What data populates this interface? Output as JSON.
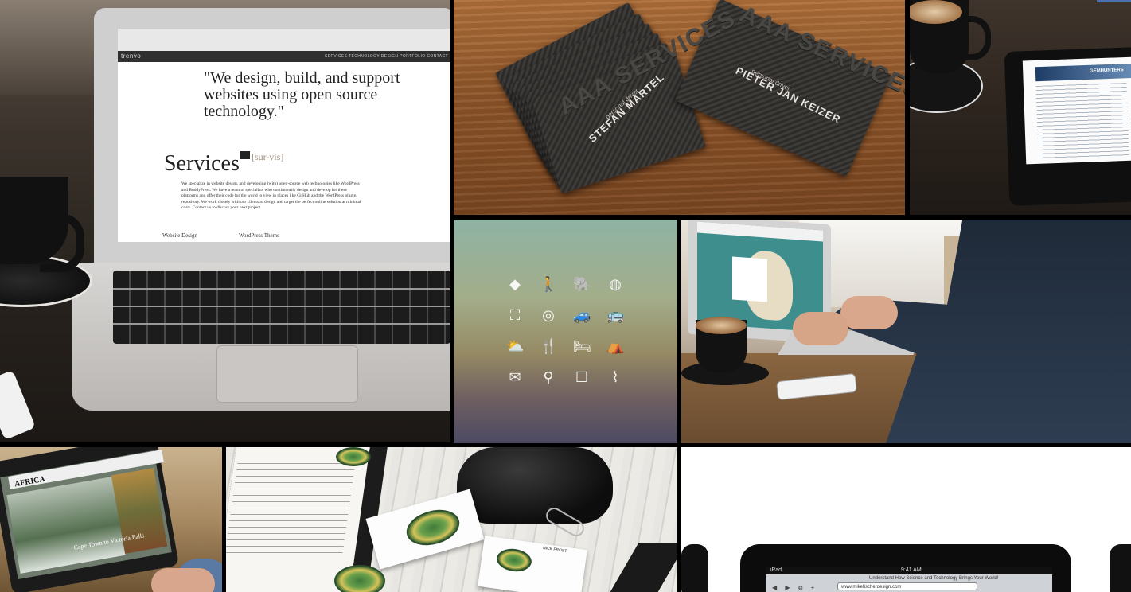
{
  "gallery": {
    "tile1": {
      "alt_label": "laptop-website",
      "brand": "trenvo",
      "nav": "SERVICES   TECHNOLOGY   DESIGN   PORTFOLIO   CONTACT",
      "quote": "\"We design, build, and support websites using open source technology.\"",
      "services_title": "Services",
      "services_sub": "[sur-vis]",
      "paragraph": "We specialize in website design, and developing (with) open-source web technologies like WordPress and BuddyPress. We have a team of specialists who continuously design and develop for these platforms and offer their code for the world to view in places like GitHub and the WordPress plugin repository. We work closely with our clients to design and target the perfect online solution at minimal costs. Contact us to discuss your next project.",
      "footer_left": "Website Design",
      "footer_right": "WordPress Theme"
    },
    "tile2": {
      "card1_logo": "AAA SERVICES",
      "card1_name": "STEFAN MARTEL",
      "card1_role": "personal driver",
      "card2_logo": "AAA SERVICES",
      "card2_name": "PIETER JAN KEIZER",
      "card2_role": "personal driver"
    },
    "tile3": {
      "site_title": "GEMHUNTERS"
    },
    "tile4": {
      "icons": [
        "africa-icon",
        "hiker-icon",
        "elephant-icon",
        "globe-icon",
        "binoculars-icon",
        "compass-icon",
        "jeep-icon",
        "bus-icon",
        "sunset-icon",
        "cutlery-icon",
        "bed-icon",
        "tent-icon",
        "mail-icon",
        "search-icon",
        "chat-icon",
        "paperclip-icon"
      ],
      "glyphs": [
        "◆",
        "🚶",
        "🐘",
        "◍",
        "⛶",
        "◎",
        "🚙",
        "🚌",
        "⛅",
        "🍴",
        "🛏",
        "⛺",
        "✉",
        "⚲",
        "☐",
        "⌇"
      ]
    },
    "tile6": {
      "site_title": "AFRICA",
      "caption": "Cape Town to Victoria Falls"
    },
    "tile7": {
      "card_name": "NICK FROST"
    },
    "tile8": {
      "device": "iPad",
      "time": "9:41 AM",
      "header": "Understand How Science and Technology Brings Your World!",
      "url": "www.mikefischerdesign.com"
    }
  }
}
